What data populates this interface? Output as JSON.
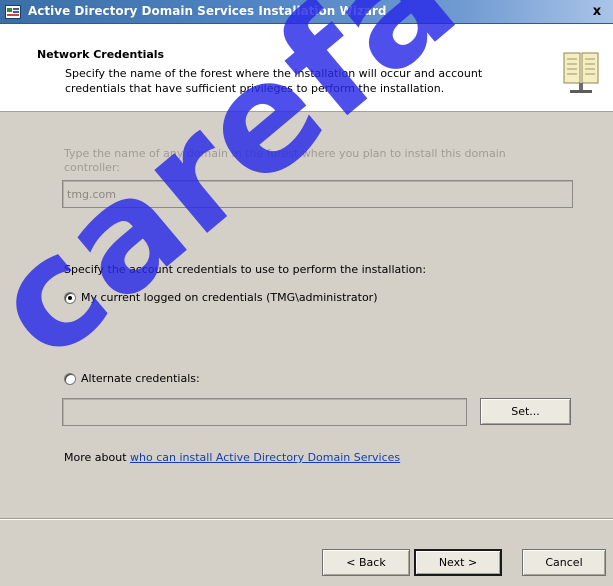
{
  "window": {
    "title": "Active Directory Domain Services Installation Wizard",
    "close_label": "x"
  },
  "header": {
    "title": "Network Credentials",
    "description": "Specify the name of the forest where the installation will occur and account credentials that have sufficient privileges to perform the installation."
  },
  "domain": {
    "prompt": "Type the name of any domain in the forest where you plan to install this domain controller:",
    "value": "tmg.com"
  },
  "credentials": {
    "prompt": "Specify the account credentials to use to perform the installation:",
    "current_label": "My current logged on credentials (TMG\\administrator)",
    "current_checked": true,
    "alternate_label": "Alternate credentials:",
    "alternate_checked": false,
    "alternate_value": "",
    "set_button": "Set..."
  },
  "more": {
    "prefix": "More about ",
    "link": "who can install Active Directory Domain Services"
  },
  "footer": {
    "back": "< Back",
    "next": "Next >",
    "cancel": "Cancel"
  },
  "watermark": "carefatem",
  "colors": {
    "titlebar": "#3a6ea5",
    "dialog_bg": "#d4d0c8",
    "link": "#1a3caa",
    "watermark": "#2828e6"
  },
  "icons": {
    "app": "ad-wizard-icon",
    "header": "book-icon",
    "close": "close-icon"
  }
}
